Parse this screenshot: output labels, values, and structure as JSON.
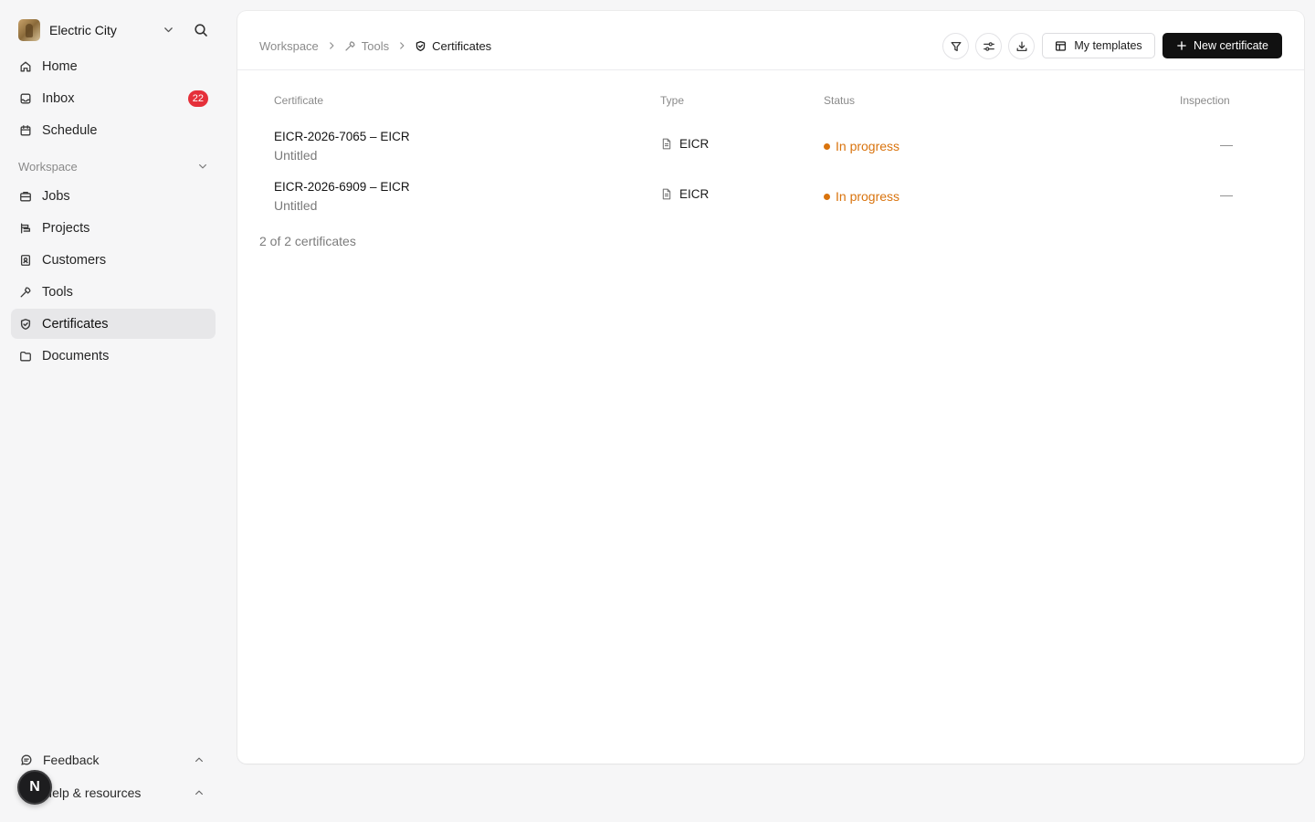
{
  "sidebar": {
    "org_name": "Electric City",
    "nav": [
      {
        "label": "Home",
        "icon": "home-icon"
      },
      {
        "label": "Inbox",
        "icon": "inbox-icon",
        "badge": "22"
      },
      {
        "label": "Schedule",
        "icon": "calendar-icon"
      }
    ],
    "section_label": "Workspace",
    "workspace_items": [
      {
        "label": "Jobs",
        "icon": "briefcase-icon"
      },
      {
        "label": "Projects",
        "icon": "projects-icon"
      },
      {
        "label": "Customers",
        "icon": "contacts-icon"
      },
      {
        "label": "Tools",
        "icon": "tools-icon"
      },
      {
        "label": "Certificates",
        "icon": "shield-check-icon",
        "active": true
      },
      {
        "label": "Documents",
        "icon": "folder-icon"
      }
    ],
    "footer": {
      "feedback_label": "Feedback",
      "help_label": "Help & resources",
      "user_initial": "N"
    }
  },
  "header": {
    "breadcrumb": [
      "Workspace",
      "Tools",
      "Certificates"
    ],
    "my_templates_label": "My templates",
    "new_certificate_label": "New certificate"
  },
  "table": {
    "columns": [
      "Certificate",
      "Type",
      "Status",
      "Inspection"
    ],
    "rows": [
      {
        "title": "EICR-2026-7065 – EICR",
        "subtitle": "Untitled",
        "type": "EICR",
        "status": "In progress",
        "inspection": "—"
      },
      {
        "title": "EICR-2026-6909 – EICR",
        "subtitle": "Untitled",
        "type": "EICR",
        "status": "In progress",
        "inspection": "—"
      }
    ],
    "count_text": "2 of 2 certificates"
  },
  "colors": {
    "status_in_progress": "#d9730d",
    "badge": "#e5303a",
    "primary_button": "#111111"
  }
}
